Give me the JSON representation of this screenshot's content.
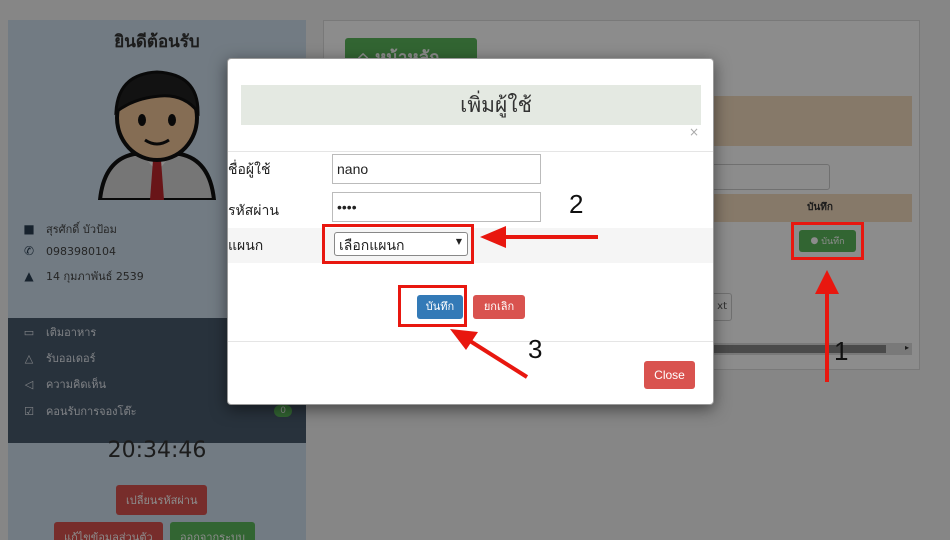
{
  "sidebar": {
    "welcome": "ยินดีต้อนรับ",
    "user_name": "สุรศักดิ์ บัวป้อม",
    "phone": "0983980104",
    "birthdate": "14 กุมภาพันธ์ 2539",
    "menu": [
      {
        "label": "เติมอาหาร",
        "icon": "tv-icon"
      },
      {
        "label": "รับออเดอร์",
        "icon": "bell-icon"
      },
      {
        "label": "ความคิดเห็น",
        "icon": "megaphone-icon"
      },
      {
        "label": "คอนรับการจองโต๊ะ",
        "icon": "check-square-icon",
        "badge": "0"
      }
    ],
    "clock": "20:34:46",
    "change_password": "เปลี่ยนรหัสผ่าน",
    "edit_profile": "แก้ไขข้อมูลส่วนตัว",
    "logout": "ออกจากระบบ"
  },
  "main": {
    "home_button": "หน้าหลัก",
    "save_column_header": "บันทึก",
    "row_save_button": "บันทึก",
    "next_button": "xt"
  },
  "modal": {
    "title": "เพิ่มผู้ใช้",
    "close_x": "×",
    "username_label": "ชื่อผู้ใช้",
    "username_value": "nano",
    "password_label": "รหัสผ่าน",
    "password_value": "••••",
    "department_label": "แผนก",
    "department_selected": "เลือกแผนก",
    "save_button": "บันทึก",
    "cancel_button": "ยกเลิก",
    "close_button": "Close"
  },
  "annotations": {
    "step1": "1",
    "step2": "2",
    "step3": "3",
    "color": "#e8170f"
  }
}
